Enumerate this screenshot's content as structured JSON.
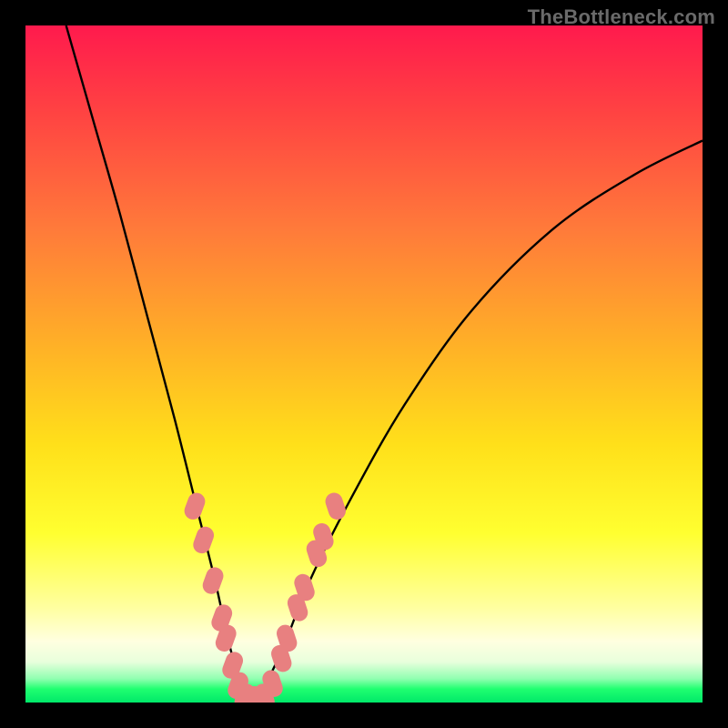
{
  "watermark": "TheBottleneck.com",
  "colors": {
    "black": "#000000",
    "curve": "#000000",
    "marker": "#e88080",
    "watermark": "#6a6a6a"
  },
  "chart_data": {
    "type": "line",
    "title": "",
    "xlabel": "",
    "ylabel": "",
    "xlim": [
      0,
      100
    ],
    "ylim": [
      0,
      100
    ],
    "grid": false,
    "series": [
      {
        "name": "bottleneck-curve",
        "note": "Approximate shape of the black V-curve; x is normalized horizontal position, y is normalized height (0 = bottom/green, 100 = top/red). Curve dips to ~0 near x≈33.",
        "x": [
          6,
          10,
          14,
          18,
          22,
          25,
          28,
          30,
          32,
          33,
          35,
          38,
          42,
          48,
          56,
          66,
          78,
          90,
          100
        ],
        "y": [
          100,
          86,
          72,
          57,
          42,
          30,
          18,
          9,
          2,
          0,
          2,
          8,
          18,
          30,
          44,
          58,
          70,
          78,
          83
        ]
      }
    ],
    "markers": {
      "name": "highlighted-pink-segments",
      "note": "Pink capsule markers along the lower part of the V; same x/y coordinate system.",
      "points": [
        {
          "x": 25.0,
          "y": 29
        },
        {
          "x": 26.3,
          "y": 24
        },
        {
          "x": 27.7,
          "y": 18
        },
        {
          "x": 29.0,
          "y": 12.5
        },
        {
          "x": 29.6,
          "y": 9.5
        },
        {
          "x": 30.6,
          "y": 5.5
        },
        {
          "x": 31.4,
          "y": 2.5
        },
        {
          "x": 32.4,
          "y": 0.8
        },
        {
          "x": 33.8,
          "y": 0.4
        },
        {
          "x": 35.3,
          "y": 0.8
        },
        {
          "x": 36.5,
          "y": 2.8
        },
        {
          "x": 37.8,
          "y": 6.5
        },
        {
          "x": 38.6,
          "y": 9.5
        },
        {
          "x": 40.2,
          "y": 14
        },
        {
          "x": 41.2,
          "y": 17
        },
        {
          "x": 43.0,
          "y": 22
        },
        {
          "x": 44.0,
          "y": 24.5
        },
        {
          "x": 45.8,
          "y": 29
        }
      ]
    }
  }
}
